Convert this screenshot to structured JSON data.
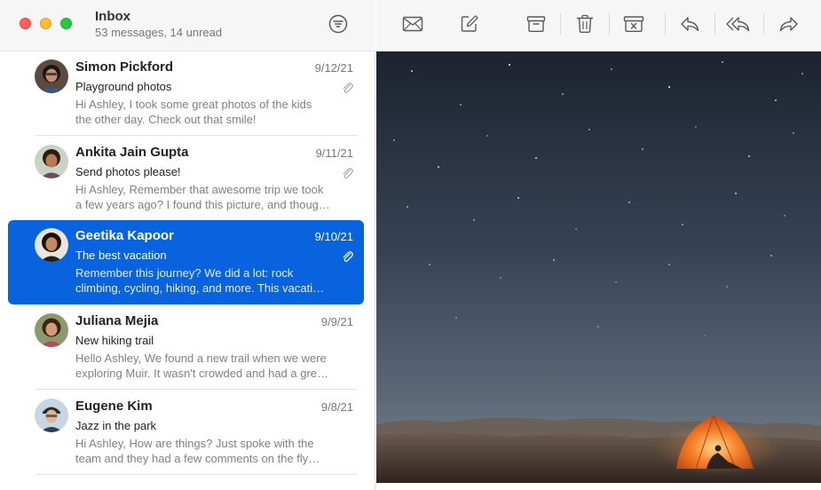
{
  "window": {
    "controls": [
      "close",
      "minimize",
      "zoom"
    ]
  },
  "mailbox": {
    "title": "Inbox",
    "subtitle": "53 messages, 14 unread"
  },
  "toolbar": {
    "icons": [
      "envelope-icon",
      "compose-icon",
      "archive-icon",
      "trash-icon",
      "junk-icon",
      "reply-icon",
      "reply-all-icon",
      "forward-icon"
    ]
  },
  "messages": [
    {
      "sender": "Simon Pickford",
      "date": "9/12/21",
      "subject": "Playground photos",
      "preview_line1": "Hi Ashley, I took some great photos of the kids",
      "preview_line2": "the other day. Check out that smile!",
      "attachment": true,
      "selected": false
    },
    {
      "sender": "Ankita Jain Gupta",
      "date": "9/11/21",
      "subject": "Send photos please!",
      "preview_line1": "Hi Ashley, Remember that awesome trip we took",
      "preview_line2": "a few years ago? I found this picture, and thoug…",
      "attachment": true,
      "selected": false
    },
    {
      "sender": "Geetika Kapoor",
      "date": "9/10/21",
      "subject": "The best vacation",
      "preview_line1": "Remember this journey? We did a lot: rock",
      "preview_line2": "climbing, cycling, hiking, and more. This vacati…",
      "attachment": true,
      "selected": true
    },
    {
      "sender": "Juliana Mejia",
      "date": "9/9/21",
      "subject": "New hiking trail",
      "preview_line1": "Hello Ashley, We found a new trail when we were",
      "preview_line2": "exploring Muir. It wasn't crowded and had a gre…",
      "attachment": false,
      "selected": false
    },
    {
      "sender": "Eugene Kim",
      "date": "9/8/21",
      "subject": "Jazz in the park",
      "preview_line1": "Hi Ashley, How are things? Just spoke with the",
      "preview_line2": "team and they had a few comments on the fly…",
      "attachment": false,
      "selected": false
    }
  ],
  "colors": {
    "selection": "#0a63de",
    "close": "#fe5f57",
    "minimize": "#febc2e",
    "zoom": "#28c840"
  }
}
